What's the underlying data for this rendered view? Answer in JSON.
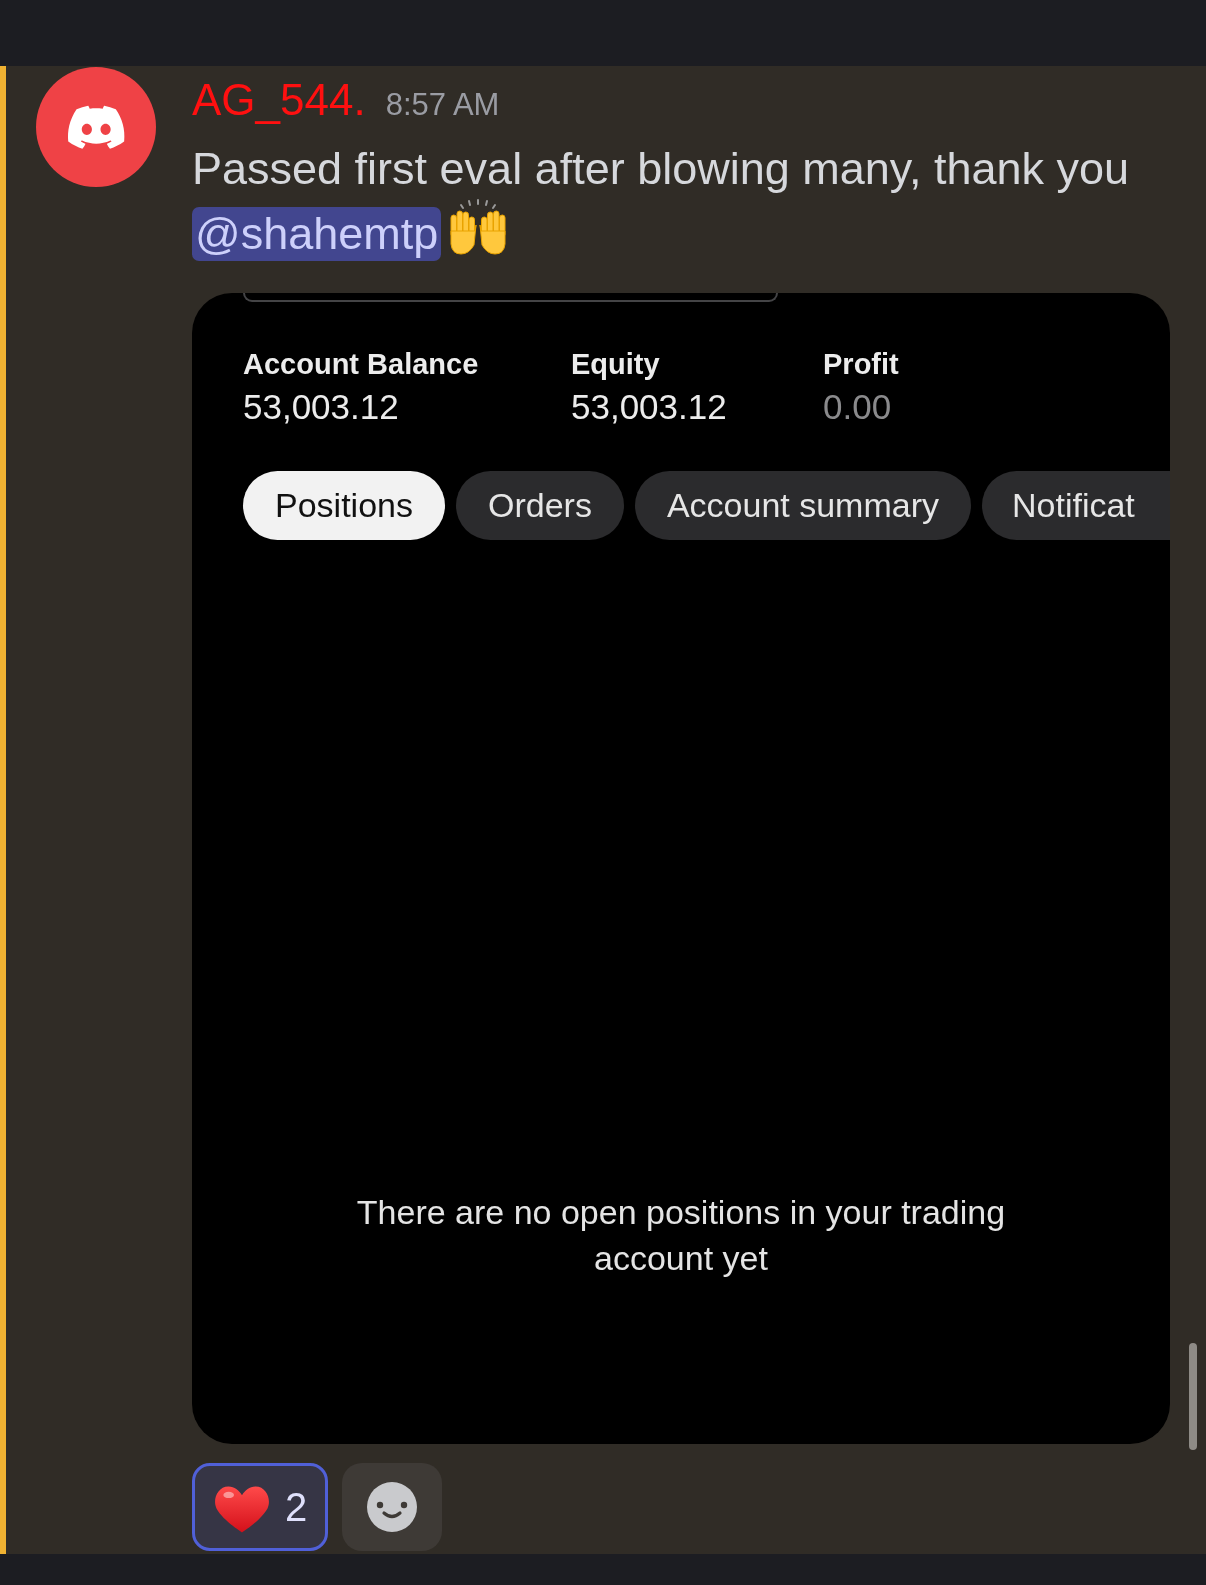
{
  "message": {
    "author": "AG_544.",
    "time": "8:57 AM",
    "text": "Passed first eval after blowing many, thank you",
    "mention": "@shahemtp"
  },
  "embed": {
    "stats": [
      {
        "label": "Account Balance",
        "value": "53,003.12",
        "muted": false
      },
      {
        "label": "Equity",
        "value": "53,003.12",
        "muted": false
      },
      {
        "label": "Profit",
        "value": "0.00",
        "muted": true
      }
    ],
    "tabs": [
      {
        "label": "Positions",
        "selected": true
      },
      {
        "label": "Orders",
        "selected": false
      },
      {
        "label": "Account summary",
        "selected": false
      },
      {
        "label": "Notificat",
        "selected": false
      }
    ],
    "empty_message": "There are no open positions in your trading account yet"
  },
  "reactions": [
    {
      "count": "2",
      "selected": true
    }
  ]
}
